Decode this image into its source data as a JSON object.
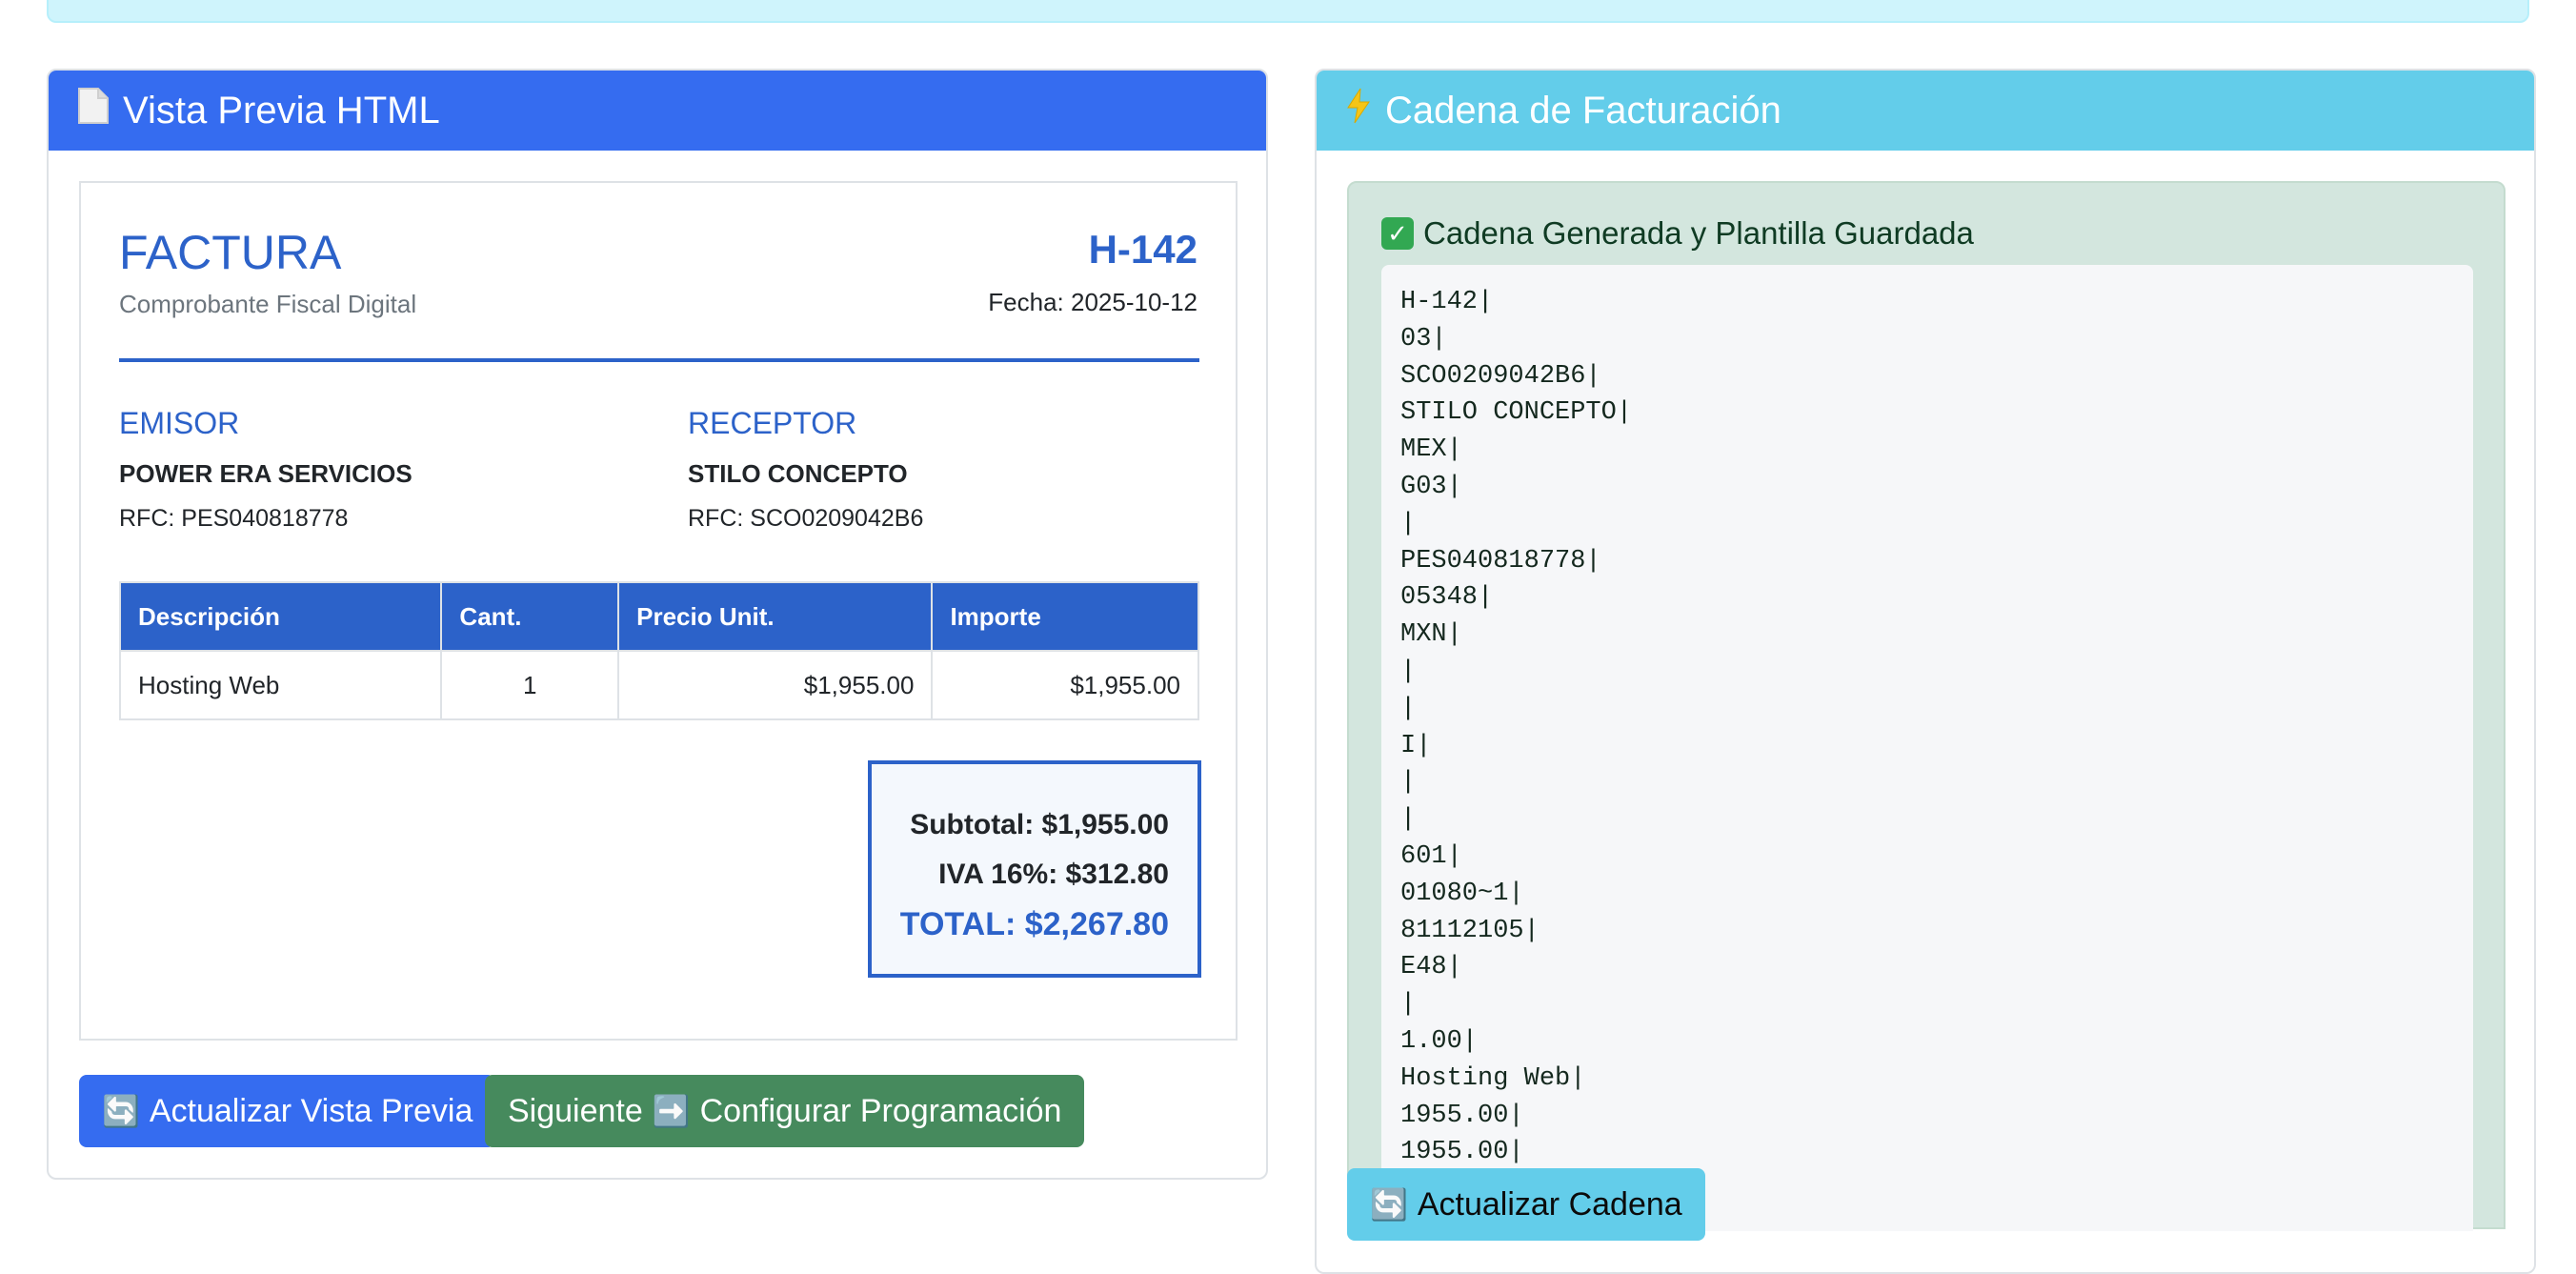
{
  "preview_card": {
    "title": "Vista Previa HTML",
    "icon": "document-icon"
  },
  "invoice": {
    "title": "FACTURA",
    "subtitle": "Comprobante Fiscal Digital",
    "number": "H-142",
    "date": "Fecha: 2025-10-12",
    "emisor": {
      "heading": "EMISOR",
      "name": "POWER ERA SERVICIOS",
      "rfc": "RFC: PES040818778"
    },
    "receptor": {
      "heading": "RECEPTOR",
      "name": "STILO CONCEPTO",
      "rfc": "RFC: SCO0209042B6"
    },
    "table": {
      "headers": [
        "Descripción",
        "Cant.",
        "Precio Unit.",
        "Importe"
      ],
      "rows": [
        [
          "Hosting Web",
          "1",
          "$1,955.00",
          "$1,955.00"
        ]
      ]
    },
    "totals": {
      "subtotal": "Subtotal: $1,955.00",
      "iva": "IVA 16%: $312.80",
      "total": "TOTAL: $2,267.80"
    }
  },
  "preview_buttons": {
    "refresh": "Actualizar Vista Previa",
    "next_prefix": "Siguiente",
    "next_suffix": "Configurar Programación"
  },
  "cadena_card": {
    "title": "Cadena de Facturación",
    "icon": "lightning-icon",
    "alert_title": "Cadena Generada y Plantilla Guardada",
    "lines": [
      "H-142|",
      "03|",
      "SCO0209042B6|",
      "STILO CONCEPTO|",
      "MEX|",
      "G03|",
      "|",
      "PES040818778|",
      "05348|",
      "MXN|",
      "|",
      "|",
      "I|",
      "|",
      "|",
      "601|",
      "01080~1|",
      "81112105|",
      "E48|",
      "|",
      "1.00|",
      "Hosting Web|",
      "1955.00|",
      "1955.00|"
    ],
    "refresh_button": "Actualizar Cadena"
  },
  "colors": {
    "primary": "#356cf0",
    "info": "#63cdea",
    "success": "#468a5d",
    "invoice_blue": "#2c62c9"
  }
}
